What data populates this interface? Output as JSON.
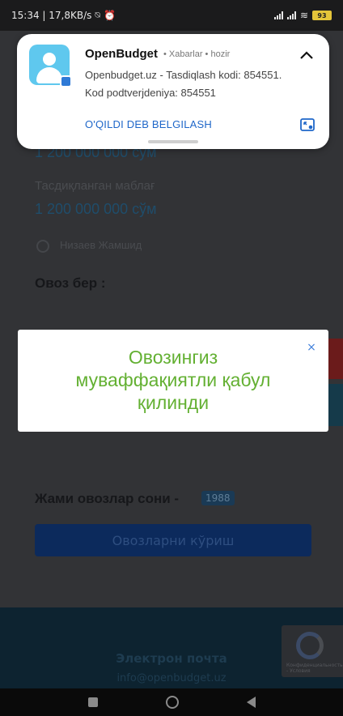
{
  "status_bar": {
    "time_speed": "15:34 | 17,8KB/s",
    "battery": "93"
  },
  "page": {
    "amount_top": "1 200 000 000 сўм",
    "confirmed_label": "Тасдиқланган маблағ",
    "confirmed_amount": "1 200 000 000 сўм",
    "author": "Низаев Жамшид",
    "vote_heading": "Овоз бер   :",
    "total_votes_label": "Жами овозлар сони -",
    "total_votes_count": "1988",
    "see_votes_button": "Овозларни кўриш",
    "footer_email_label": "Электрон почта",
    "footer_email": "info@openbudget.uz",
    "recaptcha_text": "Конфиденциальность - Условия"
  },
  "notification": {
    "app_name": "OpenBudget",
    "channel": "Xabarlar",
    "time": "hozir",
    "line1": "Openbudget.uz - Tasdiqlash kodi: 854551.",
    "line2": "Kod podtverjdeniya: 854551",
    "action": "O'QILDI DEB BELGILASH"
  },
  "toast": {
    "message": "Овозингиз\nмуваффақиятли қабул\nқилинди",
    "close": "×"
  },
  "colors": {
    "toast_text": "#63b032",
    "notification_action": "#1f67c9",
    "app_icon": "#5fc8ee"
  }
}
